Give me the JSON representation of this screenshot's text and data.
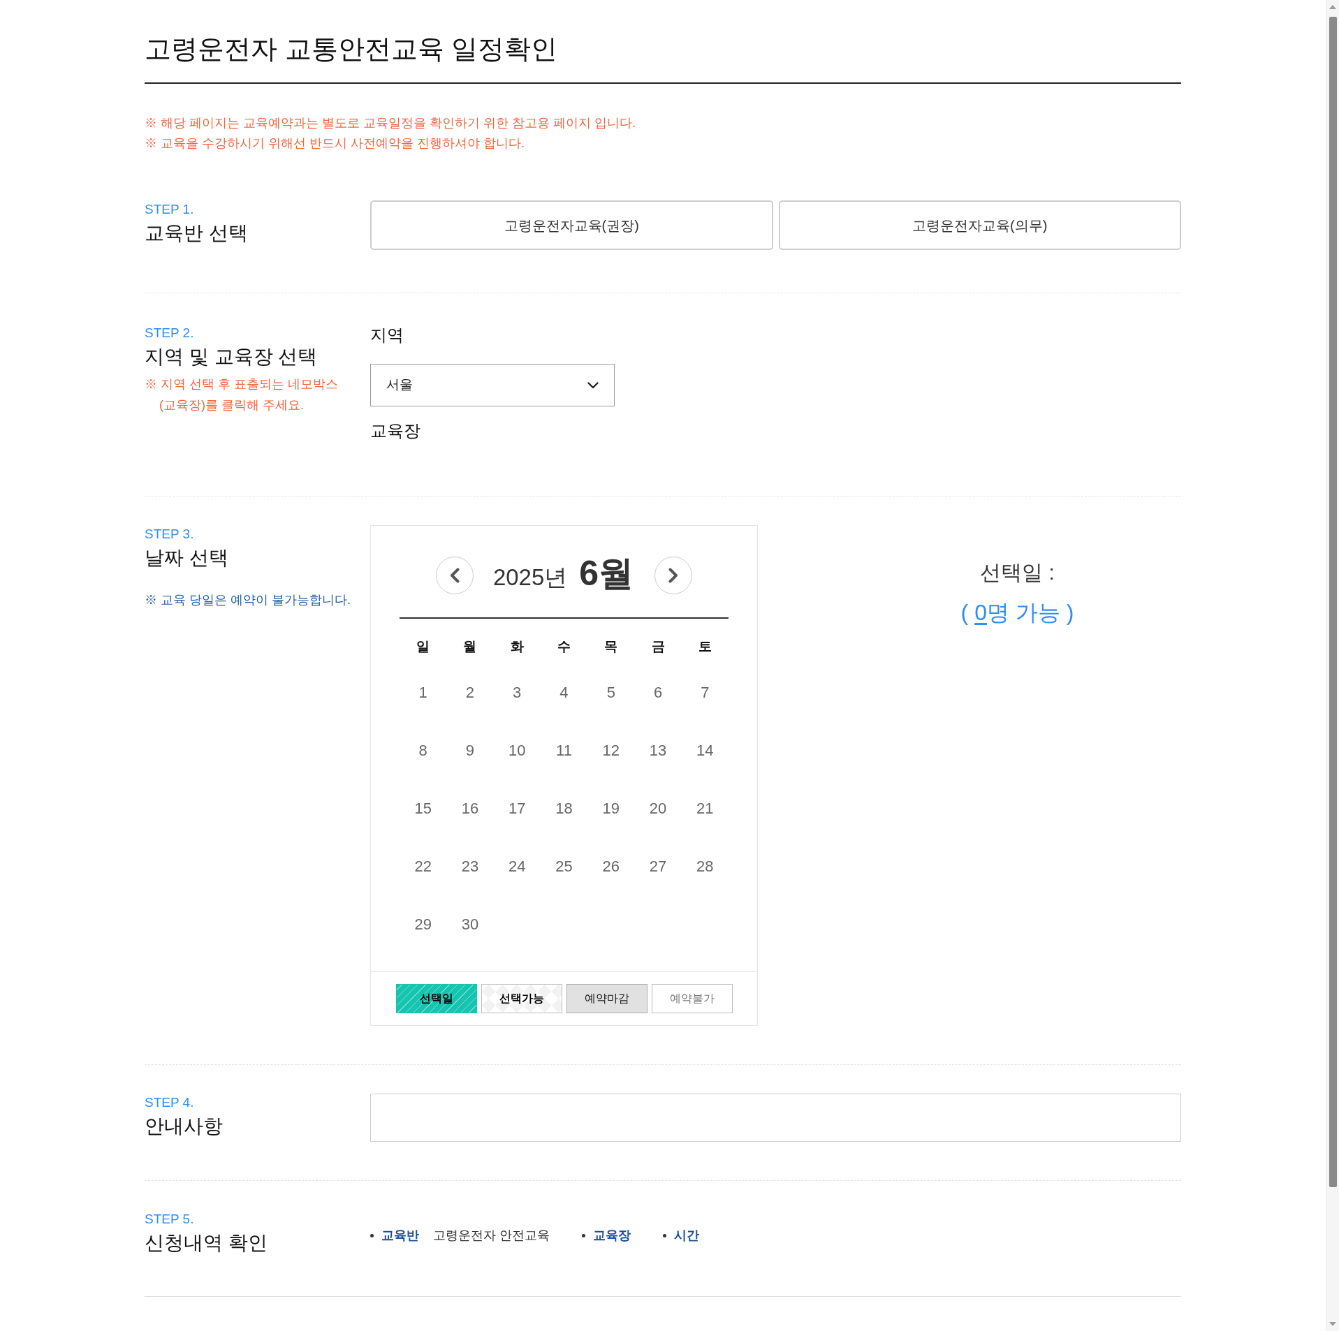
{
  "page": {
    "title": "고령운전자 교통안전교육 일정확인",
    "notices": [
      "※ 해당 페이지는 교육예약과는 별도로 교육일정을 확인하기 위한 참고용 페이지 입니다.",
      "※ 교육을 수강하시기 위해선 반드시 사전예약을 진행하셔야 합니다."
    ]
  },
  "step1": {
    "step": "STEP 1.",
    "heading": "교육반 선택",
    "options": [
      {
        "label": "고령운전자교육(권장)",
        "selected": false
      },
      {
        "label": "고령운전자교육(의무)",
        "selected": false
      }
    ]
  },
  "step2": {
    "step": "STEP 2.",
    "heading": "지역 및 교육장 선택",
    "note": "※ 지역 선택 후 표출되는 네모박스 (교육장)를 클릭해 주세요.",
    "region": {
      "label": "지역",
      "value": "서울"
    },
    "venue": {
      "label": "교육장"
    }
  },
  "step3": {
    "step": "STEP 3.",
    "heading": "날짜 선택",
    "note": "※ 교육 당일은 예약이 불가능합니다.",
    "calendar": {
      "year": "2025년",
      "month": "6월",
      "weekdays": [
        "일",
        "월",
        "화",
        "수",
        "목",
        "금",
        "토"
      ],
      "days": [
        "1",
        "2",
        "3",
        "4",
        "5",
        "6",
        "7",
        "8",
        "9",
        "10",
        "11",
        "12",
        "13",
        "14",
        "15",
        "16",
        "17",
        "18",
        "19",
        "20",
        "21",
        "22",
        "23",
        "24",
        "25",
        "26",
        "27",
        "28",
        "29",
        "30"
      ]
    },
    "legend": [
      {
        "kind": "selected",
        "label": "선택일"
      },
      {
        "kind": "available",
        "label": "선택가능"
      },
      {
        "kind": "closed",
        "label": "예약마감"
      },
      {
        "kind": "unavailable",
        "label": "예약불가"
      }
    ],
    "selection": {
      "label": "선택일 :",
      "open": "(",
      "count": "0",
      "unit": "명 가능",
      "close": ")"
    }
  },
  "step4": {
    "step": "STEP 4.",
    "heading": "안내사항"
  },
  "step5": {
    "step": "STEP 5.",
    "heading": "신청내역 확인",
    "items": [
      {
        "label": "교육반",
        "value": "고령운전자 안전교육"
      },
      {
        "label": "교육장"
      },
      {
        "label": "시간"
      }
    ]
  }
}
